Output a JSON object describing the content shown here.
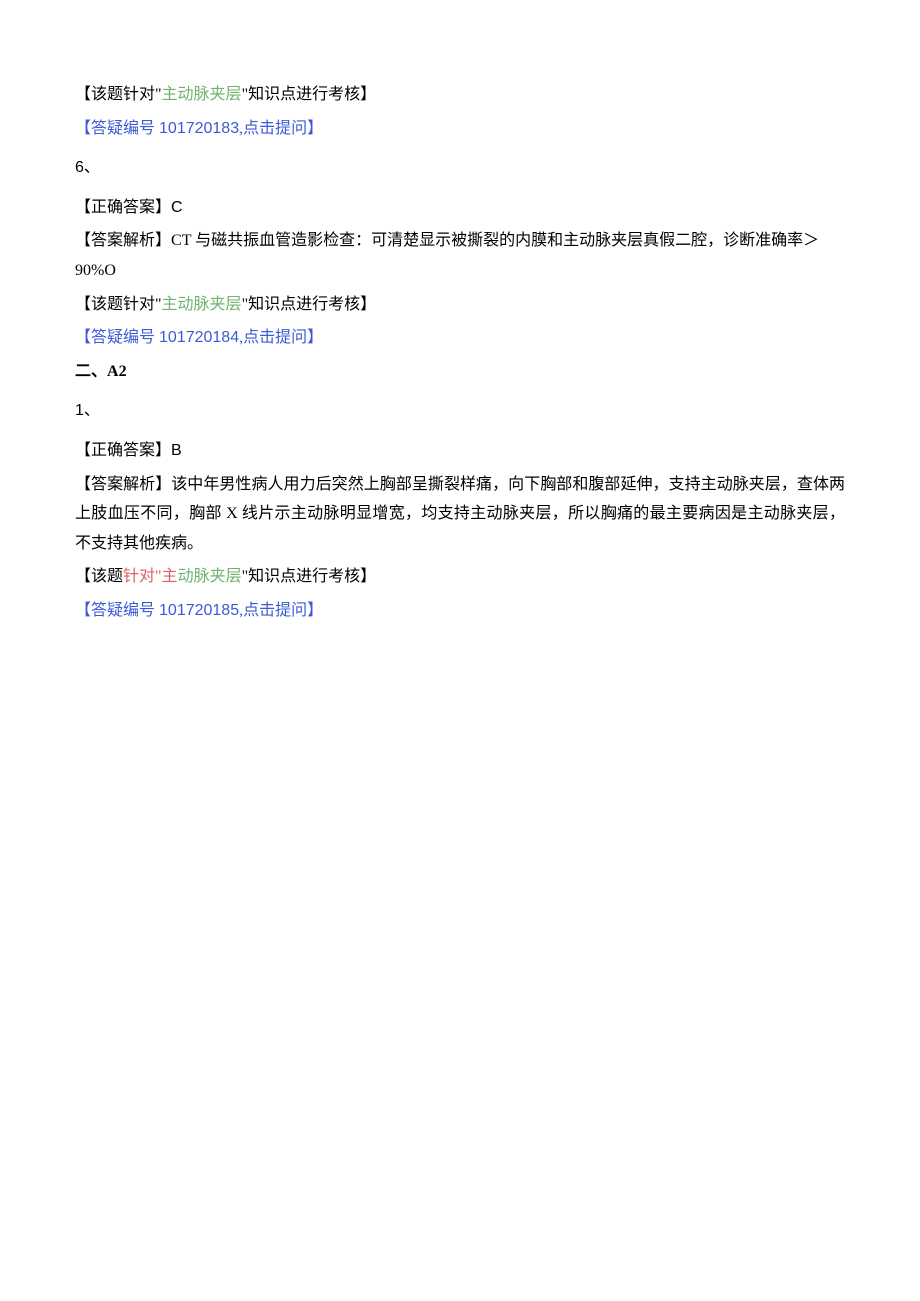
{
  "item1": {
    "note_prefix": "【该题针对\"",
    "note_topic": "主动脉夹层",
    "note_suffix": "\"知识点进行考核】",
    "ask_prefix": "【答疑编号 ",
    "ask_id": "101720183",
    "ask_suffix": ",点击提问】"
  },
  "item2": {
    "num": "6、",
    "ans_label": "【正确答案】",
    "ans_value": "C",
    "analysis_label": "【答案解析】",
    "analysis_text": "CT 与磁共振血管造影检查：可清楚显示被撕裂的内膜和主动脉夹层真假二腔，诊断准确率＞90%O",
    "note_prefix": "【该题针对\"",
    "note_topic": "主动脉夹层",
    "note_suffix": "\"知识点进行考核】",
    "ask_prefix": "【答疑编号 ",
    "ask_id": "101720184",
    "ask_suffix": ",点击提问】"
  },
  "section": {
    "prefix": "二、",
    "label": "A2"
  },
  "item3": {
    "num": "1、",
    "ans_label": "【正确答案】",
    "ans_value": "B",
    "analysis_label": "【答案解析】",
    "analysis_text": "该中年男性病人用力后突然上胸部呈撕裂样痛，向下胸部和腹部延伸，支持主动脉夹层，查体两上肢血压不同，胸部 X 线片示主动脉明显增宽，均支持主动脉夹层，所以胸痛的最主要病因是主动脉夹层，不支持其他疾病。",
    "note_prefix_a": "【该题",
    "note_prefix_b": "针对\"主",
    "note_topic": "动脉夹层",
    "note_suffix": "\"知识点进行考核】",
    "ask_prefix": "【答疑编号 ",
    "ask_id": "101720185",
    "ask_suffix": ",点击提问】"
  }
}
